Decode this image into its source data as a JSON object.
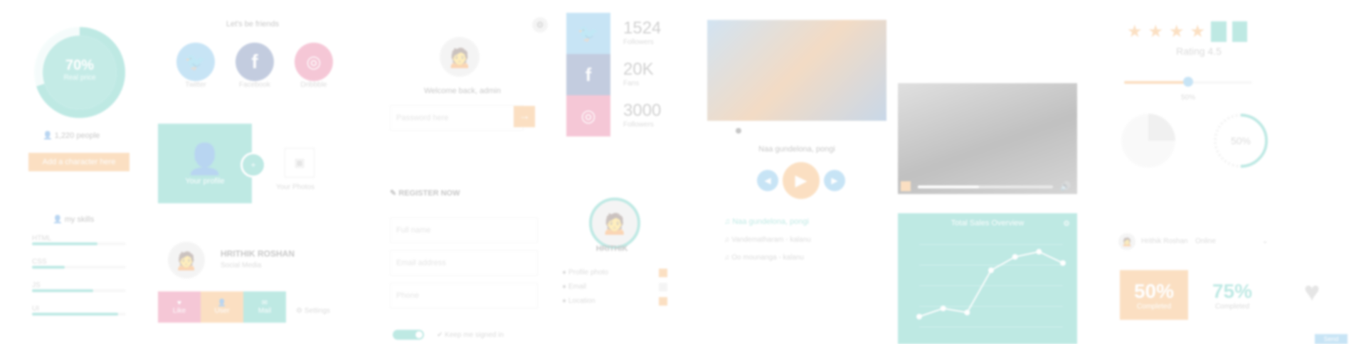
{
  "left_col": {
    "donut": {
      "percent_text": "70%",
      "label": "Real price",
      "value_pct": 70
    },
    "people_text": "1,220 people",
    "download_button": "Add a character here",
    "skills_title": "my skills",
    "skills": [
      {
        "label": "HTML",
        "pct": 70
      },
      {
        "label": "CSS",
        "pct": 35
      },
      {
        "label": "JS",
        "pct": 65
      },
      {
        "label": "UI",
        "pct": 92
      }
    ]
  },
  "social": {
    "title": "Let's be friends",
    "items": [
      {
        "label": "Twitter",
        "icon": "twitter-icon"
      },
      {
        "label": "Facebook",
        "icon": "facebook-icon"
      },
      {
        "label": "Dribbble",
        "icon": "dribbble-icon"
      }
    ],
    "profile_tile": {
      "label": "Your profile"
    },
    "photos_label": "Your Photos",
    "person": {
      "name": "HRITHIK ROSHAN",
      "subtitle": "Social Media"
    },
    "actions": [
      "Like",
      "User",
      "Mail"
    ],
    "settings_label": "Settings"
  },
  "login": {
    "welcome": "Welcome back, admin",
    "password_placeholder": "Password here",
    "register_title": "REGISTER NOW",
    "fields": [
      "Full name",
      "Email address",
      "Phone"
    ],
    "remember_label": "Keep me signed in"
  },
  "stats": [
    {
      "value": "1524",
      "label": "Followers",
      "color": "#4aa7e0"
    },
    {
      "value": "20K",
      "label": "Fans",
      "color": "#4667a6"
    },
    {
      "value": "3000",
      "label": "Followers",
      "color": "#e0487b"
    }
  ],
  "contact": {
    "name": "HRITHIK",
    "rows": [
      "Profile photo",
      "Email",
      "Location"
    ]
  },
  "media": {
    "song_title": "Naa gundelona, pongi",
    "playlist": [
      "Naa gundelona, pongi",
      "Vandematharam - kalanu",
      "Oo mounanga - kalanu"
    ],
    "progress_pct": 45
  },
  "chart_panel": {
    "title": "Total Sales Overview",
    "chart_data": {
      "type": "line",
      "x": [
        1,
        2,
        3,
        4,
        5,
        6,
        7
      ],
      "values": [
        10,
        18,
        14,
        55,
        68,
        73,
        62
      ],
      "title": "Total Sales Overview"
    }
  },
  "rating": {
    "text": "Rating 4.5",
    "stars": 6,
    "slider_pct": 50,
    "slider_text": "50%",
    "pie_pct": "50%"
  },
  "cards": [
    {
      "pct": "50%",
      "label": "Completed"
    },
    {
      "pct": "75%",
      "label": "Completed"
    }
  ],
  "bottom_right_button": "Send",
  "mini_profile": {
    "name": "Hrithik Roshan",
    "sub": "Online"
  }
}
